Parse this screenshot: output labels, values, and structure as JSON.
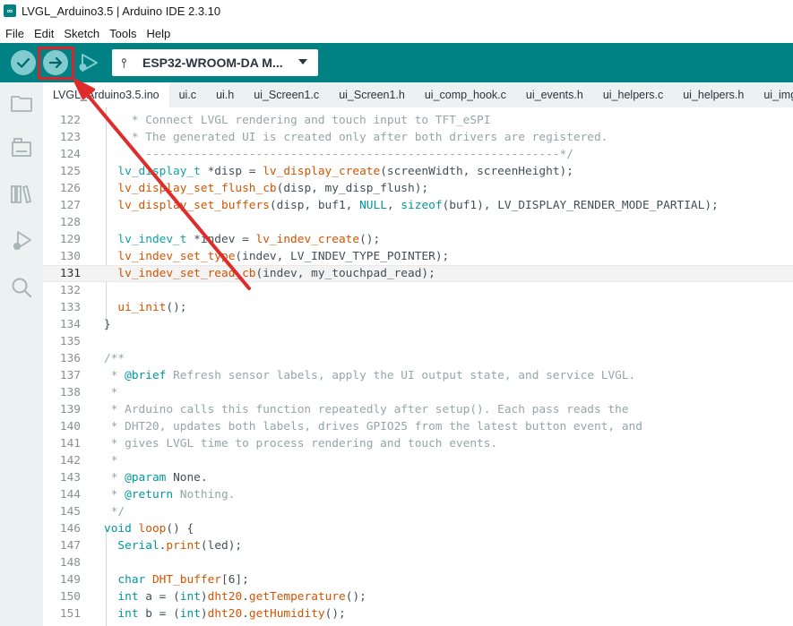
{
  "window": {
    "title": "LVGL_Arduino3.5 | Arduino IDE 2.3.10"
  },
  "menu": [
    "File",
    "Edit",
    "Sketch",
    "Tools",
    "Help"
  ],
  "toolbar": {
    "verify_icon": "check-icon",
    "upload_icon": "arrow-right-icon",
    "debug_icon": "debug-play-icon",
    "board": "ESP32-WROOM-DA M...",
    "accent": "#008184",
    "highlight_color": "#d9232d"
  },
  "sidebar": {
    "icons": [
      "folder-icon",
      "board-manager-icon",
      "library-icon",
      "debug-icon",
      "search-icon"
    ]
  },
  "tabs": [
    "LVGL_Arduino3.5.ino",
    "ui.c",
    "ui.h",
    "ui_Screen1.c",
    "ui_Screen1.h",
    "ui_comp_hook.c",
    "ui_events.h",
    "ui_helpers.c",
    "ui_helpers.h",
    "ui_img_b"
  ],
  "active_tab": 0,
  "current_line": 131,
  "lines": [
    {
      "n": "122",
      "segs": [
        [
          "c-comment",
          "    * Connect LVGL rendering and touch input to TFT_eSPI"
        ]
      ]
    },
    {
      "n": "123",
      "segs": [
        [
          "c-comment",
          "    * The generated UI is created only after both drivers are registered."
        ]
      ]
    },
    {
      "n": "124",
      "segs": [
        [
          "c-comment",
          "    * ------------------------------------------------------------*/"
        ]
      ]
    },
    {
      "n": "125",
      "segs": [
        [
          "c-plain",
          "  "
        ],
        [
          "c-type",
          "lv_display_t"
        ],
        [
          "c-plain",
          " *disp = "
        ],
        [
          "c-func",
          "lv_display_create"
        ],
        [
          "c-plain",
          "(screenWidth, screenHeight);"
        ]
      ]
    },
    {
      "n": "126",
      "segs": [
        [
          "c-plain",
          "  "
        ],
        [
          "c-func",
          "lv_display_set_flush_cb"
        ],
        [
          "c-plain",
          "(disp, my_disp_flush);"
        ]
      ]
    },
    {
      "n": "127",
      "segs": [
        [
          "c-plain",
          "  "
        ],
        [
          "c-func",
          "lv_display_set_buffers"
        ],
        [
          "c-plain",
          "(disp, buf1, "
        ],
        [
          "c-kw",
          "NULL"
        ],
        [
          "c-plain",
          ", "
        ],
        [
          "c-kw",
          "sizeof"
        ],
        [
          "c-plain",
          "(buf1), LV_DISPLAY_RENDER_MODE_PARTIAL);"
        ]
      ]
    },
    {
      "n": "128",
      "segs": []
    },
    {
      "n": "129",
      "segs": [
        [
          "c-plain",
          "  "
        ],
        [
          "c-type",
          "lv_indev_t"
        ],
        [
          "c-plain",
          " *indev = "
        ],
        [
          "c-func",
          "lv_indev_create"
        ],
        [
          "c-plain",
          "();"
        ]
      ]
    },
    {
      "n": "130",
      "segs": [
        [
          "c-plain",
          "  "
        ],
        [
          "c-func",
          "lv_indev_set_type"
        ],
        [
          "c-plain",
          "(indev, LV_INDEV_TYPE_POINTER);"
        ]
      ]
    },
    {
      "n": "131",
      "segs": [
        [
          "c-plain",
          "  "
        ],
        [
          "c-func",
          "lv_indev_set_read_cb"
        ],
        [
          "c-plain",
          "(indev, my_touchpad_read);"
        ]
      ]
    },
    {
      "n": "132",
      "segs": []
    },
    {
      "n": "133",
      "segs": [
        [
          "c-plain",
          "  "
        ],
        [
          "c-func",
          "ui_init"
        ],
        [
          "c-plain",
          "();"
        ]
      ]
    },
    {
      "n": "134",
      "segs": [
        [
          "c-plain",
          "}"
        ]
      ]
    },
    {
      "n": "135",
      "segs": []
    },
    {
      "n": "136",
      "segs": [
        [
          "c-comment",
          "/**"
        ]
      ]
    },
    {
      "n": "137",
      "segs": [
        [
          "c-comment",
          " * "
        ],
        [
          "c-kw",
          "@brief"
        ],
        [
          "c-comment",
          " Refresh sensor labels, apply the UI output state, and service LVGL."
        ]
      ]
    },
    {
      "n": "138",
      "segs": [
        [
          "c-comment",
          " *"
        ]
      ]
    },
    {
      "n": "139",
      "segs": [
        [
          "c-comment",
          " * Arduino calls this function repeatedly after setup(). Each pass reads the"
        ]
      ]
    },
    {
      "n": "140",
      "segs": [
        [
          "c-comment",
          " * DHT20, updates both labels, drives GPIO25 from the latest button event, and"
        ]
      ]
    },
    {
      "n": "141",
      "segs": [
        [
          "c-comment",
          " * gives LVGL time to process rendering and touch events."
        ]
      ]
    },
    {
      "n": "142",
      "segs": [
        [
          "c-comment",
          " *"
        ]
      ]
    },
    {
      "n": "143",
      "segs": [
        [
          "c-comment",
          " * "
        ],
        [
          "c-kw",
          "@param"
        ],
        [
          "c-plain",
          " None."
        ]
      ]
    },
    {
      "n": "144",
      "segs": [
        [
          "c-comment",
          " * "
        ],
        [
          "c-kw",
          "@return"
        ],
        [
          "c-comment",
          " Nothing."
        ]
      ]
    },
    {
      "n": "145",
      "segs": [
        [
          "c-comment",
          " */"
        ]
      ]
    },
    {
      "n": "146",
      "segs": [
        [
          "c-kw",
          "void"
        ],
        [
          "c-plain",
          " "
        ],
        [
          "c-func",
          "loop"
        ],
        [
          "c-plain",
          "() {"
        ]
      ]
    },
    {
      "n": "147",
      "segs": [
        [
          "c-plain",
          "  "
        ],
        [
          "c-kw",
          "Serial"
        ],
        [
          "c-plain",
          "."
        ],
        [
          "c-func",
          "print"
        ],
        [
          "c-plain",
          "(led);"
        ]
      ]
    },
    {
      "n": "148",
      "segs": []
    },
    {
      "n": "149",
      "segs": [
        [
          "c-plain",
          "  "
        ],
        [
          "c-kw",
          "char"
        ],
        [
          "c-plain",
          " "
        ],
        [
          "c-func",
          "DHT_buffer"
        ],
        [
          "c-plain",
          "[6];"
        ]
      ]
    },
    {
      "n": "150",
      "segs": [
        [
          "c-plain",
          "  "
        ],
        [
          "c-kw",
          "int"
        ],
        [
          "c-plain",
          " a = ("
        ],
        [
          "c-kw",
          "int"
        ],
        [
          "c-plain",
          ")"
        ],
        [
          "c-func",
          "dht20"
        ],
        [
          "c-plain",
          "."
        ],
        [
          "c-func",
          "getTemperature"
        ],
        [
          "c-plain",
          "();"
        ]
      ]
    },
    {
      "n": "151",
      "segs": [
        [
          "c-plain",
          "  "
        ],
        [
          "c-kw",
          "int"
        ],
        [
          "c-plain",
          " b = ("
        ],
        [
          "c-kw",
          "int"
        ],
        [
          "c-plain",
          ")"
        ],
        [
          "c-func",
          "dht20"
        ],
        [
          "c-plain",
          "."
        ],
        [
          "c-func",
          "getHumidity"
        ],
        [
          "c-plain",
          "();"
        ]
      ]
    }
  ]
}
